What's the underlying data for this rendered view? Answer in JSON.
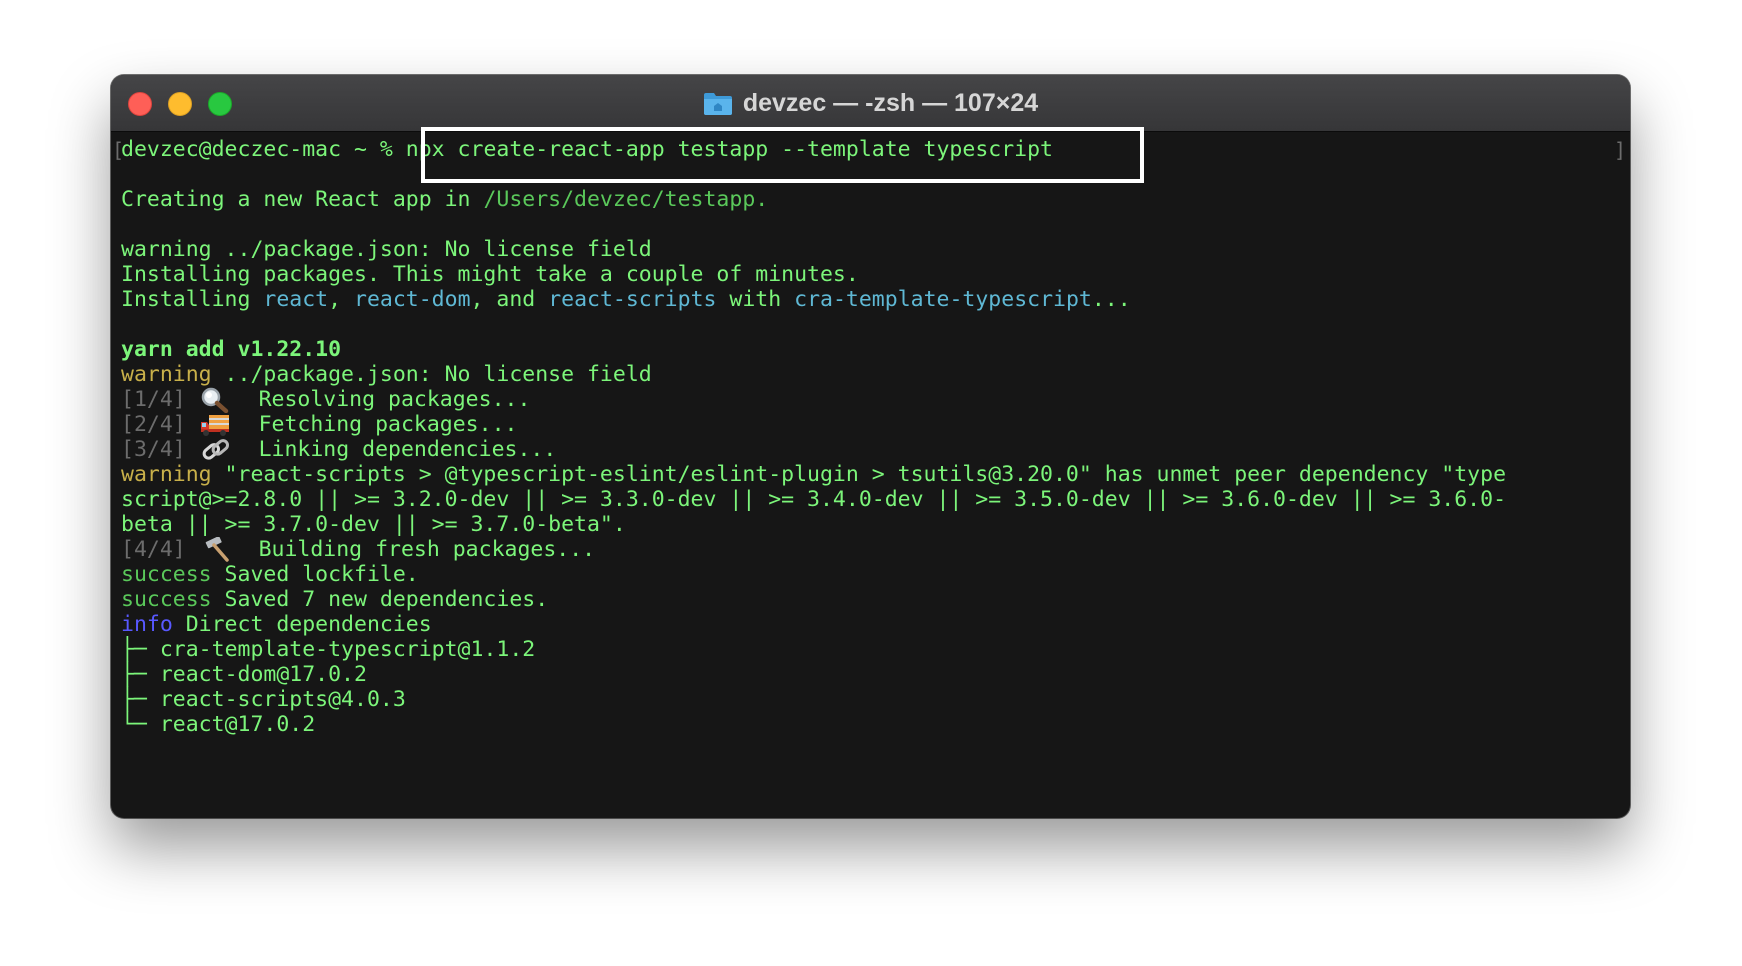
{
  "window": {
    "title": "devzec — -zsh — 107×24"
  },
  "terminal": {
    "prompt": "devzec@deczec-mac ~ % ",
    "command": "npx create-react-app testapp --template typescript",
    "creating_prefix": "Creating a new React app in ",
    "creating_path": "/Users/devzec/testapp",
    "creating_suffix": ".",
    "warn1": "warning ../package.json: No license field",
    "installing1": "Installing packages. This might take a couple of minutes.",
    "installing2_prefix": "Installing ",
    "pkg_react": "react",
    "sep1": ", ",
    "pkg_react_dom": "react-dom",
    "sep2": ", and ",
    "pkg_react_scripts": "react-scripts",
    "with": " with ",
    "pkg_template": "cra-template-typescript",
    "ellipsis": "...",
    "yarn_add": "yarn add v1.22.10",
    "warn2_label": "warning",
    "warn2_text": " ../package.json: No license field",
    "step1_tag": "[1/4]",
    "step1_text": "Resolving packages...",
    "step2_tag": "[2/4]",
    "step2_text": "Fetching packages...",
    "step3_tag": "[3/4]",
    "step3_text": "Linking dependencies...",
    "peer_label": "warning",
    "peer_line1": " \"react-scripts > @typescript-eslint/eslint-plugin > tsutils@3.20.0\" has unmet peer dependency \"type",
    "peer_line2": "script@>=2.8.0 || >= 3.2.0-dev || >= 3.3.0-dev || >= 3.4.0-dev || >= 3.5.0-dev || >= 3.6.0-dev || >= 3.6.0-",
    "peer_line3": "beta || >= 3.7.0-dev || >= 3.7.0-beta\".",
    "step4_tag": "[4/4]",
    "step4_text": "Building fresh packages...",
    "success_label": "success",
    "success1_text": " Saved lockfile.",
    "success2_text": " Saved 7 new dependencies.",
    "info_label": "info",
    "info_text": " Direct dependencies",
    "tree_branch": "├─ ",
    "tree_last": "└─ ",
    "dependencies": [
      "cra-template-typescript@1.1.2",
      "react-dom@17.0.2",
      "react-scripts@4.0.3",
      "react@17.0.2"
    ],
    "icons": {
      "step1": "magnifying-glass-icon",
      "step2": "truck-icon",
      "step3": "link-icon",
      "step4": "hammer-icon"
    }
  },
  "colors": {
    "text_green": "#7cf57a",
    "path_cyan": "#5fb8d4",
    "dim_gray": "#6c6c6c",
    "warning_yellow": "#c8b04a",
    "info_blue": "#5858ff",
    "close": "#fe5f57",
    "minimize": "#febc2e",
    "zoom": "#28c840"
  }
}
